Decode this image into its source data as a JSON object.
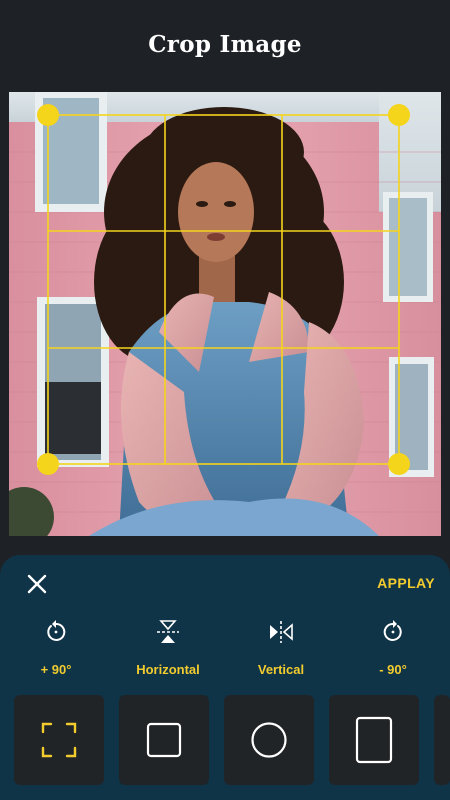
{
  "header": {
    "title": "Crop Image"
  },
  "colors": {
    "accent": "#f2cc2f",
    "panel": "#0f3347",
    "background": "#1e2126",
    "tile": "#212426",
    "crop_grid": "#f5d41c"
  },
  "toolbar": {
    "close_icon": "close-icon",
    "apply_label": "APPLAY"
  },
  "tools": [
    {
      "label": "+ 90°",
      "icon": "rotate-left-icon"
    },
    {
      "label": "Horizontal",
      "icon": "flip-horizontal-icon"
    },
    {
      "label": "Vertical",
      "icon": "flip-vertical-icon"
    },
    {
      "label": "- 90°",
      "icon": "rotate-right-icon"
    }
  ],
  "shapes": [
    {
      "name": "freeform-crop",
      "icon": "crop-corners-icon",
      "selected": true
    },
    {
      "name": "square-crop",
      "icon": "square-icon",
      "selected": false
    },
    {
      "name": "circle-crop",
      "icon": "circle-icon",
      "selected": false
    },
    {
      "name": "portrait-crop",
      "icon": "rectangle-icon",
      "selected": false
    }
  ]
}
